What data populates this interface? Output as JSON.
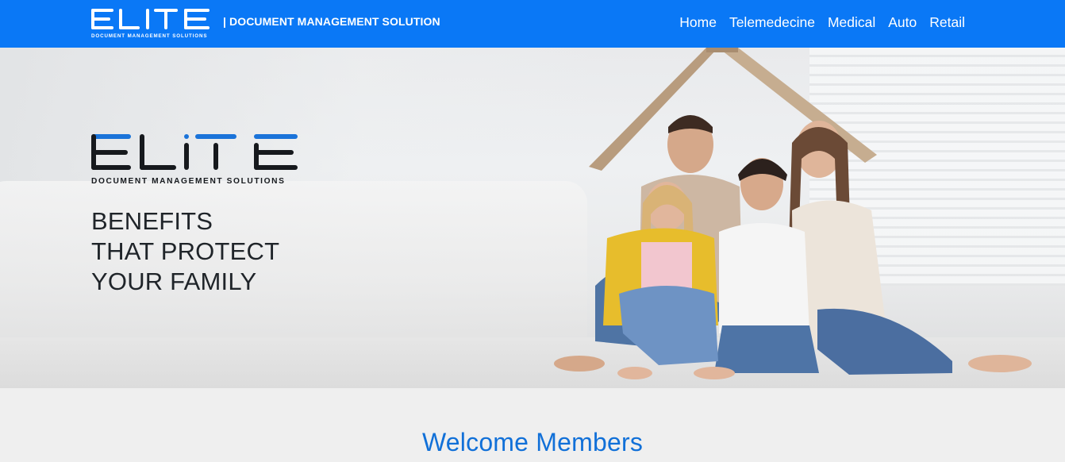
{
  "navbar": {
    "logo_word": "ELITE",
    "logo_subtext": "DOCUMENT MANAGEMENT SOLUTIONS",
    "tagline": "| DOCUMENT MANAGEMENT SOLUTION",
    "links": [
      "Home",
      "Telemedecine",
      "Medical",
      "Auto",
      "Retail"
    ],
    "background_color": "#0a78f6"
  },
  "hero": {
    "logo_word": "ELITE",
    "logo_subtext": "DOCUMENT MANAGEMENT SOLUTIONS",
    "headline_lines": [
      "BENEFITS",
      "THAT PROTECT",
      "YOUR FAMILY"
    ],
    "image_alt_icon": "family-under-cardboard-roof-photo"
  },
  "welcome": {
    "title": "Welcome Members",
    "title_color": "#1170d8"
  },
  "colors": {
    "brand_blue": "#0a78f6",
    "logo_blue": "#1a73d9",
    "logo_dark": "#16191d",
    "text_dark": "#1f2429"
  }
}
